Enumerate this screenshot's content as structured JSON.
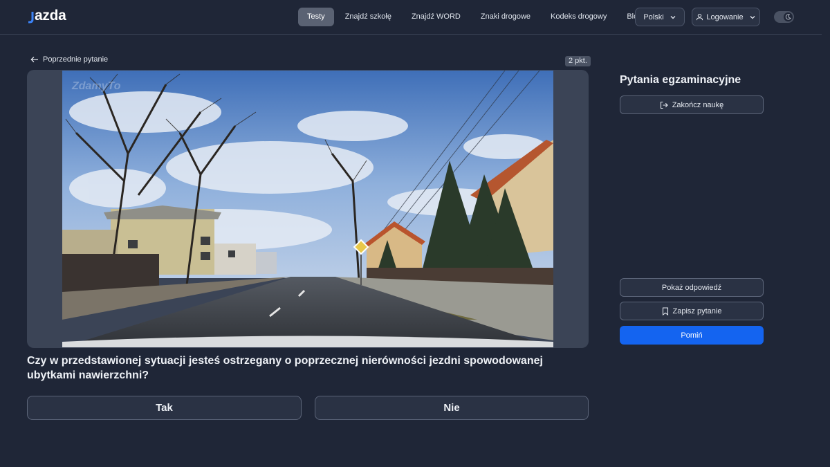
{
  "header": {
    "logo_text": "azda",
    "nav": [
      "Testy",
      "Znajdź szkołę",
      "Znajdź WORD",
      "Znaki drogowe",
      "Kodeks drogowy",
      "Blog"
    ],
    "active_nav": "Testy",
    "language_label": "Polski",
    "login_label": "Logowanie",
    "theme_toggle_icon": "moon-icon"
  },
  "question": {
    "back_label": "Poprzednie pytanie",
    "points_label": "2 pkt.",
    "media_watermark": "ZdamyTo",
    "text": "Czy w przedstawionej sytuacji jesteś ostrzegany o poprzecznej nierówności jezdni spowodowanej ubytkami nawierzchni?",
    "answers": [
      "Tak",
      "Nie"
    ]
  },
  "sidebar": {
    "title": "Pytania egzaminacyjne",
    "finish_label": "Zakończ naukę",
    "show_answer_label": "Pokaż odpowiedź",
    "save_label": "Zapisz pytanie",
    "skip_label": "Pomiń"
  },
  "colors": {
    "background": "#1f2637",
    "primary_button": "#1464f0",
    "panel": "#2a3244"
  }
}
